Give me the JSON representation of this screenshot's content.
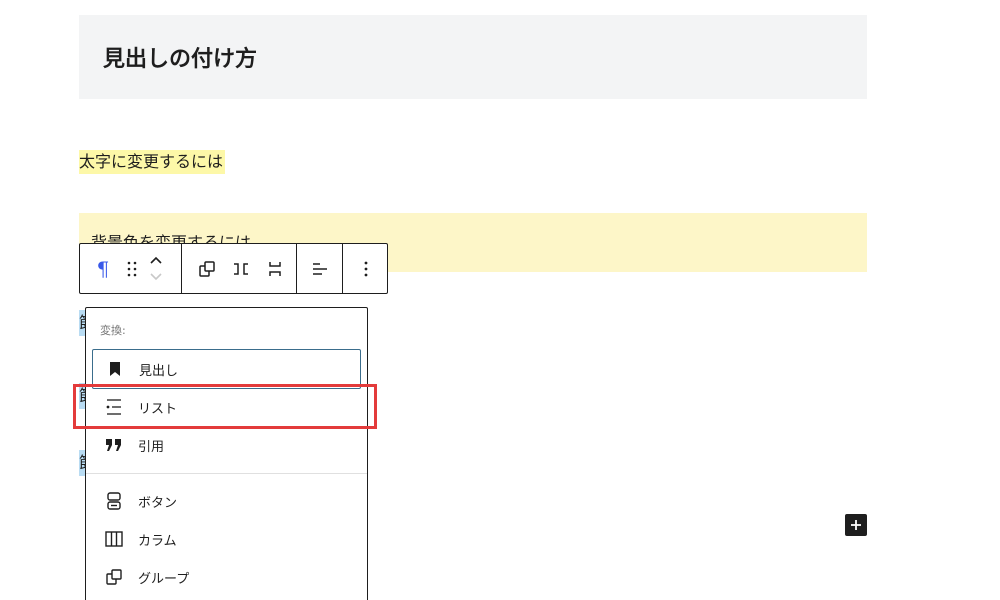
{
  "blocks": {
    "heading": "見出しの付け方",
    "bold_paragraph": "太字に変更するには",
    "background_paragraph": "背景色を変更するには",
    "highlight_char": "節"
  },
  "toolbar": {
    "block_type_icon": "paragraph-icon",
    "drag_icon": "drag-handle-icon",
    "move_up_icon": "chevron-up-icon",
    "move_down_icon": "chevron-down-icon",
    "group_icon": "group-icon",
    "row_icon": "row-icon",
    "stack_icon": "stack-icon",
    "align_icon": "align-left-icon",
    "options_icon": "more-vertical-icon"
  },
  "transform_menu": {
    "label": "変換:",
    "primary_items": [
      {
        "label": "見出し",
        "icon": "bookmark-icon"
      },
      {
        "label": "リスト",
        "icon": "list-icon"
      },
      {
        "label": "引用",
        "icon": "quote-icon"
      }
    ],
    "secondary_items": [
      {
        "label": "ボタン",
        "icon": "button-icon"
      },
      {
        "label": "カラム",
        "icon": "columns-icon"
      },
      {
        "label": "グループ",
        "icon": "group-icon"
      }
    ]
  },
  "colors": {
    "accent": "#3858e9",
    "highlight_yellow": "#fdf8a8",
    "background_block": "#fdf6c8",
    "annotation_red": "#e33b3b"
  }
}
